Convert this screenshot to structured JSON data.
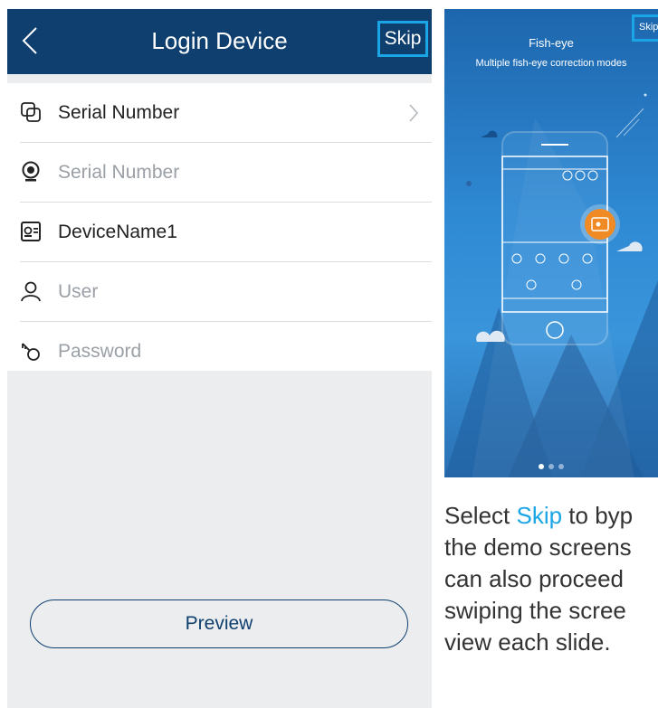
{
  "header": {
    "back_icon": "chevron-left-icon",
    "title": "Login Device",
    "skip_label": "Skip"
  },
  "form": {
    "fields": [
      {
        "icon": "link-icon",
        "text": "Serial Number",
        "placeholder": false,
        "has_chevron": true
      },
      {
        "icon": "camera-icon",
        "text": "Serial Number",
        "placeholder": true
      },
      {
        "icon": "device-card-icon",
        "text": "DeviceName1",
        "placeholder": false
      },
      {
        "icon": "user-icon",
        "text": "User",
        "placeholder": true
      },
      {
        "icon": "key-icon",
        "text": "Password",
        "placeholder": true
      }
    ]
  },
  "preview_label": "Preview",
  "demo": {
    "skip_label": "Skip",
    "title": "Fish-eye",
    "subtitle": "Multiple fish-eye correction modes",
    "dots": 3,
    "active_dot": 0
  },
  "caption": {
    "lines": [
      {
        "before": "Select ",
        "keyword": "Skip",
        "after": " to byp"
      },
      {
        "before": "the demo screens"
      },
      {
        "before": "can also proceed"
      },
      {
        "before": "swiping the scree"
      },
      {
        "before": "view each slide."
      }
    ]
  },
  "colors": {
    "navbar": "#0f3f6e",
    "highlight": "#1aa6e6",
    "demo_accent": "#f08a24"
  }
}
